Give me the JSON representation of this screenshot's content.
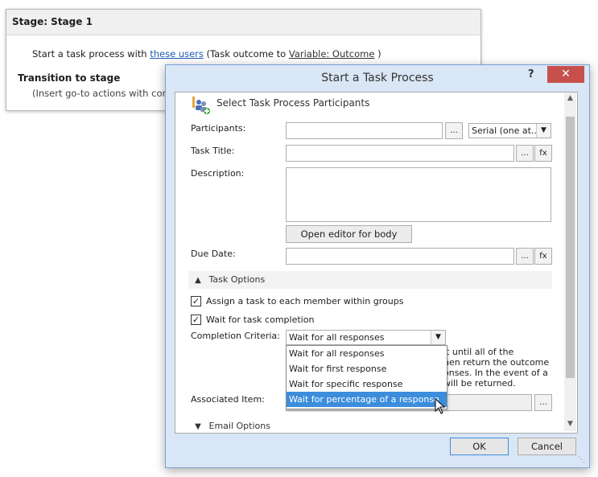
{
  "stage": {
    "title": "Stage: Stage 1",
    "action_prefix": "Start a task process with",
    "users_link": "these users",
    "action_mid": "(Task outcome to",
    "outcome_link": "Variable: Outcome",
    "action_suffix": ")",
    "transition_label": "Transition to stage",
    "insert_text": "(Insert go-to actions with condi"
  },
  "dialog": {
    "title": "Start a Task Process",
    "help": "?",
    "close": "✕",
    "section_participants": "Select Task Process Participants",
    "participants_label": "Participants:",
    "participants_value": "",
    "participants_browse": "...",
    "order_select": "Serial (one at...",
    "task_title_label": "Task Title:",
    "task_title_value": "",
    "ellipsis": "...",
    "fx": "fx",
    "description_label": "Description:",
    "description_value": "",
    "open_editor": "Open editor for body",
    "due_date_label": "Due Date:",
    "due_date_value": "",
    "task_options": "Task Options",
    "assign_each": "Assign a task to each member within groups",
    "assign_each_checked": true,
    "wait_completion": "Wait for task completion",
    "wait_completion_checked": true,
    "completion_label": "Completion Criteria:",
    "completion_selected": "Wait for all responses",
    "completion_options": [
      "Wait for all responses",
      "Wait for first response",
      "Wait for specific response",
      "Wait for percentage of a response"
    ],
    "highlighted_option": "Wait for percentage of a response",
    "help_text_lines": [
      "it until all of the",
      "hen return the outcome",
      "onses. In the event of a",
      "will be returned."
    ],
    "associated_label": "Associated Item:",
    "email_options": "Email Options",
    "ok": "OK",
    "cancel": "Cancel"
  }
}
